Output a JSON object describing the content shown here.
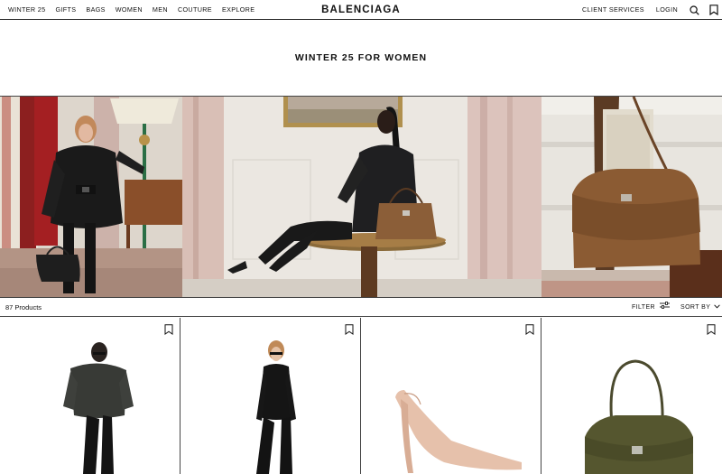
{
  "nav": {
    "links": [
      "WINTER 25",
      "GIFTS",
      "BAGS",
      "WOMEN",
      "MEN",
      "COUTURE",
      "EXPLORE"
    ],
    "logo": "BALENCIAGA",
    "client_services": "CLIENT SERVICES",
    "login": "LOGIN",
    "icons": [
      "search-icon",
      "bookmark-icon"
    ]
  },
  "page": {
    "title": "WINTER 25 FOR WOMEN"
  },
  "listing": {
    "count": "87 Products",
    "filter_label": "FILTER",
    "sort_label": "SORT BY"
  },
  "products": [
    {
      "kind": "puffer jacket outfit"
    },
    {
      "kind": "black knit outfit"
    },
    {
      "kind": "nude pointed pumps"
    },
    {
      "kind": "olive suede handbag"
    }
  ],
  "colors": {
    "text": "#111111",
    "rule": "#444444",
    "background": "#ffffff"
  }
}
